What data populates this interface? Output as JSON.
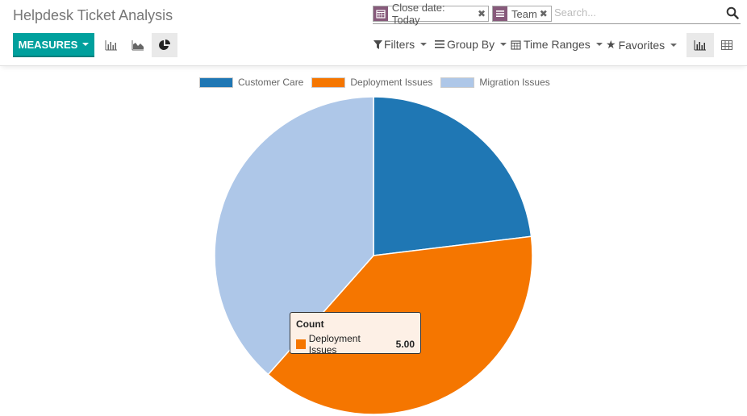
{
  "header": {
    "title": "Helpdesk Ticket Analysis"
  },
  "search": {
    "facets": [
      {
        "icon": "calendar-icon",
        "label": "Close date: Today"
      },
      {
        "icon": "group-by-icon",
        "label": "Team"
      }
    ],
    "placeholder": "Search..."
  },
  "toolbar": {
    "measures_label": "MEASURES",
    "chart_modes": [
      "bar-chart",
      "line-chart",
      "pie-chart"
    ],
    "active_mode": "pie-chart",
    "filters_label": "Filters",
    "group_by_label": "Group By",
    "time_ranges_label": "Time Ranges",
    "favorites_label": "Favorites",
    "views": [
      "graph",
      "pivot"
    ],
    "active_view": "graph"
  },
  "tooltip": {
    "title": "Count",
    "label": "Deployment Issues",
    "value": "5.00",
    "color": "#f57600"
  },
  "chart_data": {
    "type": "pie",
    "title": "",
    "measure": "Count",
    "categories": [
      "Customer Care",
      "Deployment Issues",
      "Migration Issues"
    ],
    "values": [
      3,
      5,
      5
    ],
    "colors": [
      "#1f77b4",
      "#f57600",
      "#aec7e8"
    ],
    "legend": "top",
    "start_angle": "12 o'clock, clockwise"
  }
}
